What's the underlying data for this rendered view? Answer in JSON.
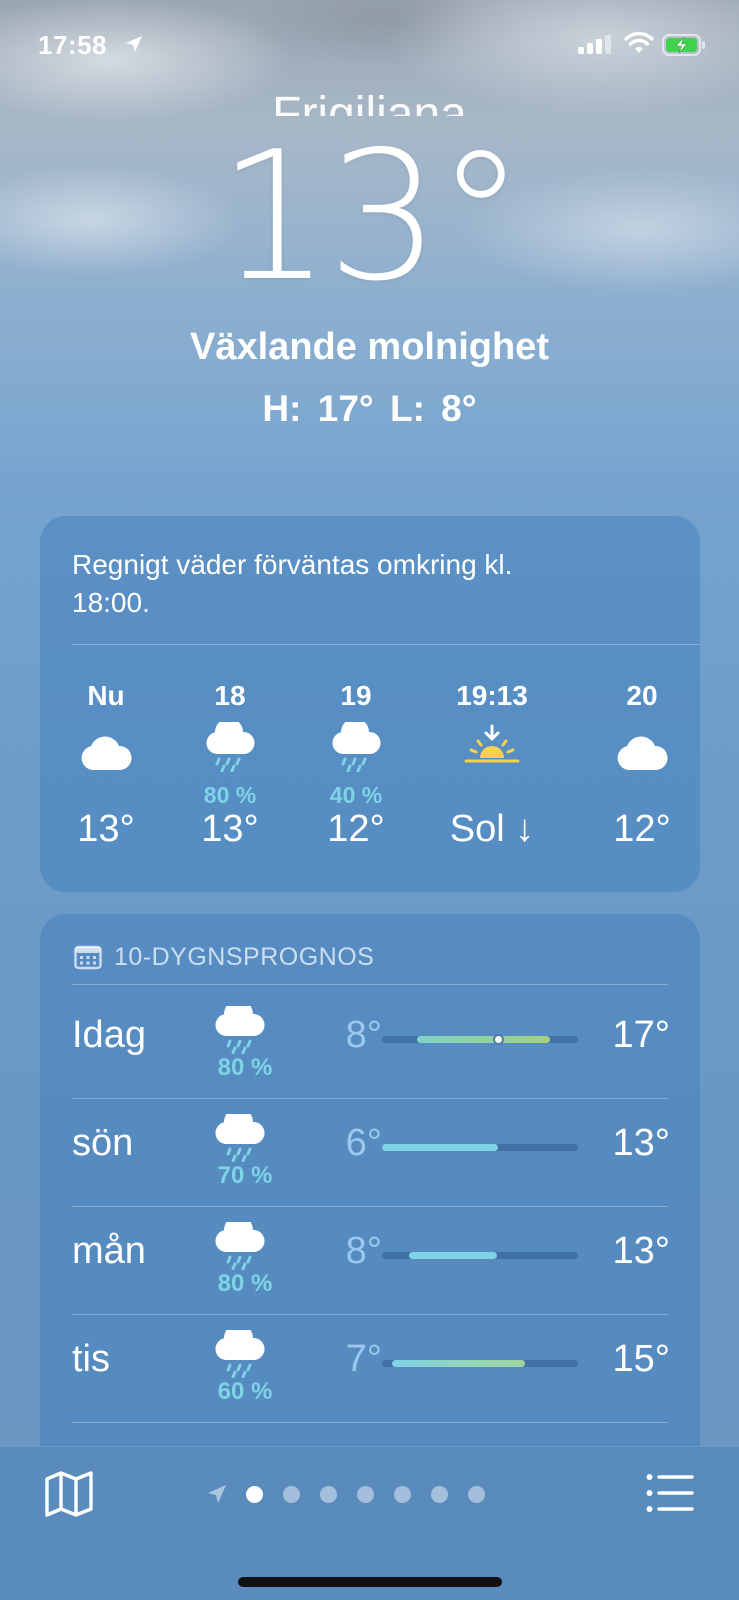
{
  "status_bar": {
    "time": "17:58"
  },
  "location": {
    "city": "Frigiliana",
    "temperature": "13°",
    "condition": "Växlande molnighet",
    "hilo": "H: 17°  L: 8°"
  },
  "hourly": {
    "alert": "Regnigt väder förväntas omkring kl. 18:00.",
    "items": [
      {
        "label": "Nu",
        "icon": "cloud-icon",
        "precip": "",
        "temp": "13°"
      },
      {
        "label": "18",
        "icon": "cloud-rain-icon",
        "precip": "80 %",
        "temp": "13°"
      },
      {
        "label": "19",
        "icon": "cloud-rain-icon",
        "precip": "40 %",
        "temp": "12°"
      },
      {
        "label": "19:13",
        "icon": "sunset-icon",
        "precip": "",
        "temp": "Sol ↓"
      },
      {
        "label": "20",
        "icon": "cloud-icon",
        "precip": "",
        "temp": "12°"
      }
    ]
  },
  "daily": {
    "header": "10-DYGNSPROGNOS",
    "days": [
      {
        "name": "Idag",
        "icon": "cloud-rain-icon",
        "precip": "80 %",
        "low": "8°",
        "high": "17°",
        "range_start": 0.18,
        "range_end": 0.86,
        "now": 0.59,
        "colors": [
          "#7fd3c8",
          "#a3d27a"
        ]
      },
      {
        "name": "sön",
        "icon": "cloud-rain-icon",
        "precip": "70 %",
        "low": "6°",
        "high": "13°",
        "range_start": 0.0,
        "range_end": 0.59,
        "colors": [
          "#7fd3e6",
          "#7fd3e6"
        ]
      },
      {
        "name": "mån",
        "icon": "cloud-rain-icon",
        "precip": "80 %",
        "low": "8°",
        "high": "13°",
        "range_start": 0.14,
        "range_end": 0.59,
        "colors": [
          "#7fd3e6",
          "#7fd3e6"
        ]
      },
      {
        "name": "tis",
        "icon": "cloud-rain-icon",
        "precip": "60 %",
        "low": "7°",
        "high": "15°",
        "range_start": 0.05,
        "range_end": 0.73,
        "colors": [
          "#7fd3e6",
          "#9fd49a"
        ]
      }
    ]
  },
  "bottom_bar": {
    "pages": 7,
    "active_page": 0
  }
}
